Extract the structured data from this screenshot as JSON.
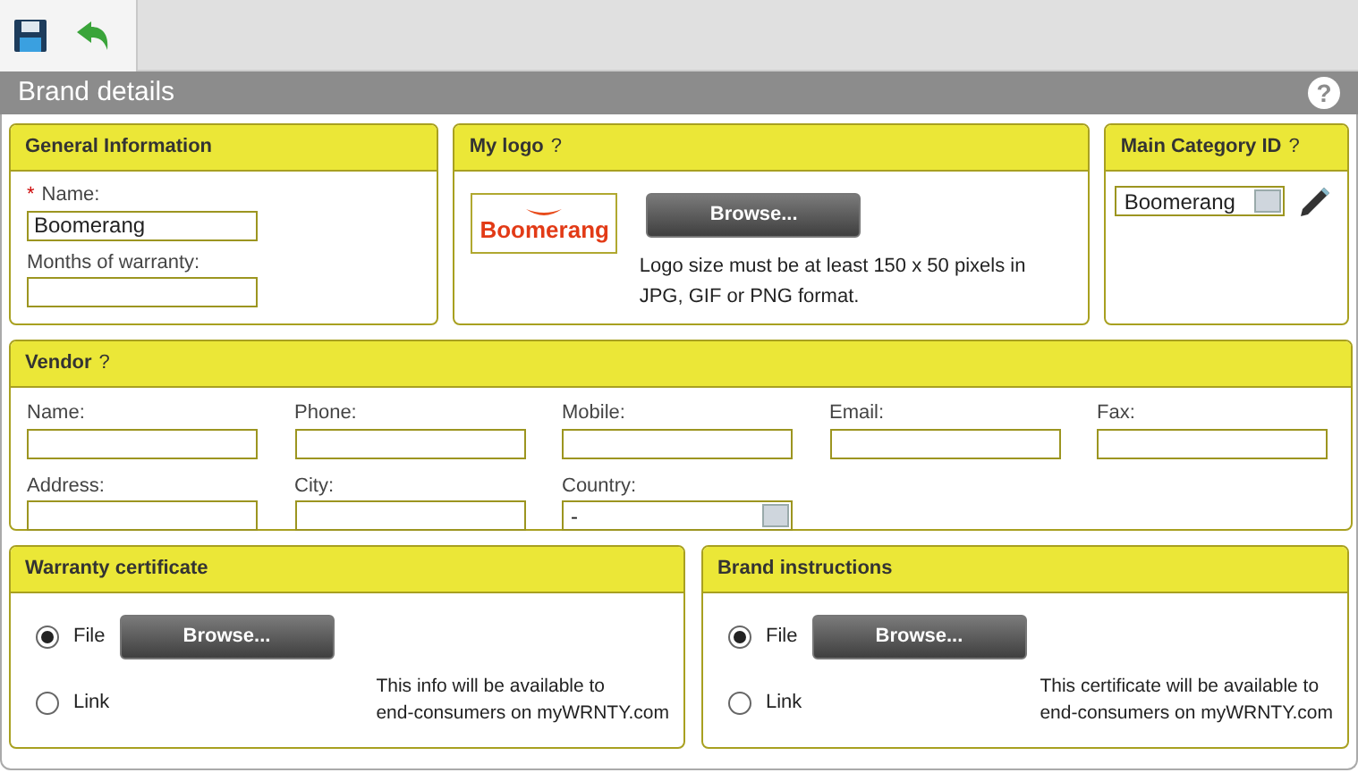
{
  "title": "Brand details",
  "title_help": "?",
  "general": {
    "title": "General Information",
    "fields": [
      {
        "label": "Name:",
        "required_mark": "*",
        "value": "Boomerang"
      },
      {
        "label": "Months of warranty:"
      }
    ]
  },
  "logo": {
    "title": "My logo",
    "help": "?",
    "logo_text": "Boomerang",
    "button": "Browse...",
    "note": [
      "Logo size must be at least 150 x 50 pixels in",
      "JPG, GIF or PNG format."
    ]
  },
  "category": {
    "title": "Main Category ID",
    "help": "?",
    "value": "Boomerang"
  },
  "vendor": {
    "title": "Vendor",
    "help": "?",
    "fields": [
      {
        "label": "Name:",
        "kind": "text"
      },
      {
        "label": "Phone:",
        "kind": "text"
      },
      {
        "label": "Mobile:",
        "kind": "text"
      },
      {
        "label": "Email:",
        "kind": "text"
      },
      {
        "label": "Fax:",
        "kind": "text"
      },
      {
        "label": "Address:",
        "kind": "text"
      },
      {
        "label": "City:",
        "kind": "text"
      },
      {
        "label": "Country:",
        "kind": "select",
        "value": "-"
      }
    ]
  },
  "attachments": [
    {
      "title": "Warranty certificate",
      "options": [
        {
          "label": "File",
          "selected": true
        },
        {
          "label": "Link",
          "selected": false
        }
      ],
      "button": "Browse...",
      "note": [
        "This info will be available to",
        "end-consumers on myWRNTY.com"
      ]
    },
    {
      "title": "Brand instructions",
      "options": [
        {
          "label": "File",
          "selected": true
        },
        {
          "label": "Link",
          "selected": false
        }
      ],
      "button": "Browse...",
      "note": [
        "This certificate will be available to",
        "end-consumers on myWRNTY.com"
      ]
    }
  ]
}
